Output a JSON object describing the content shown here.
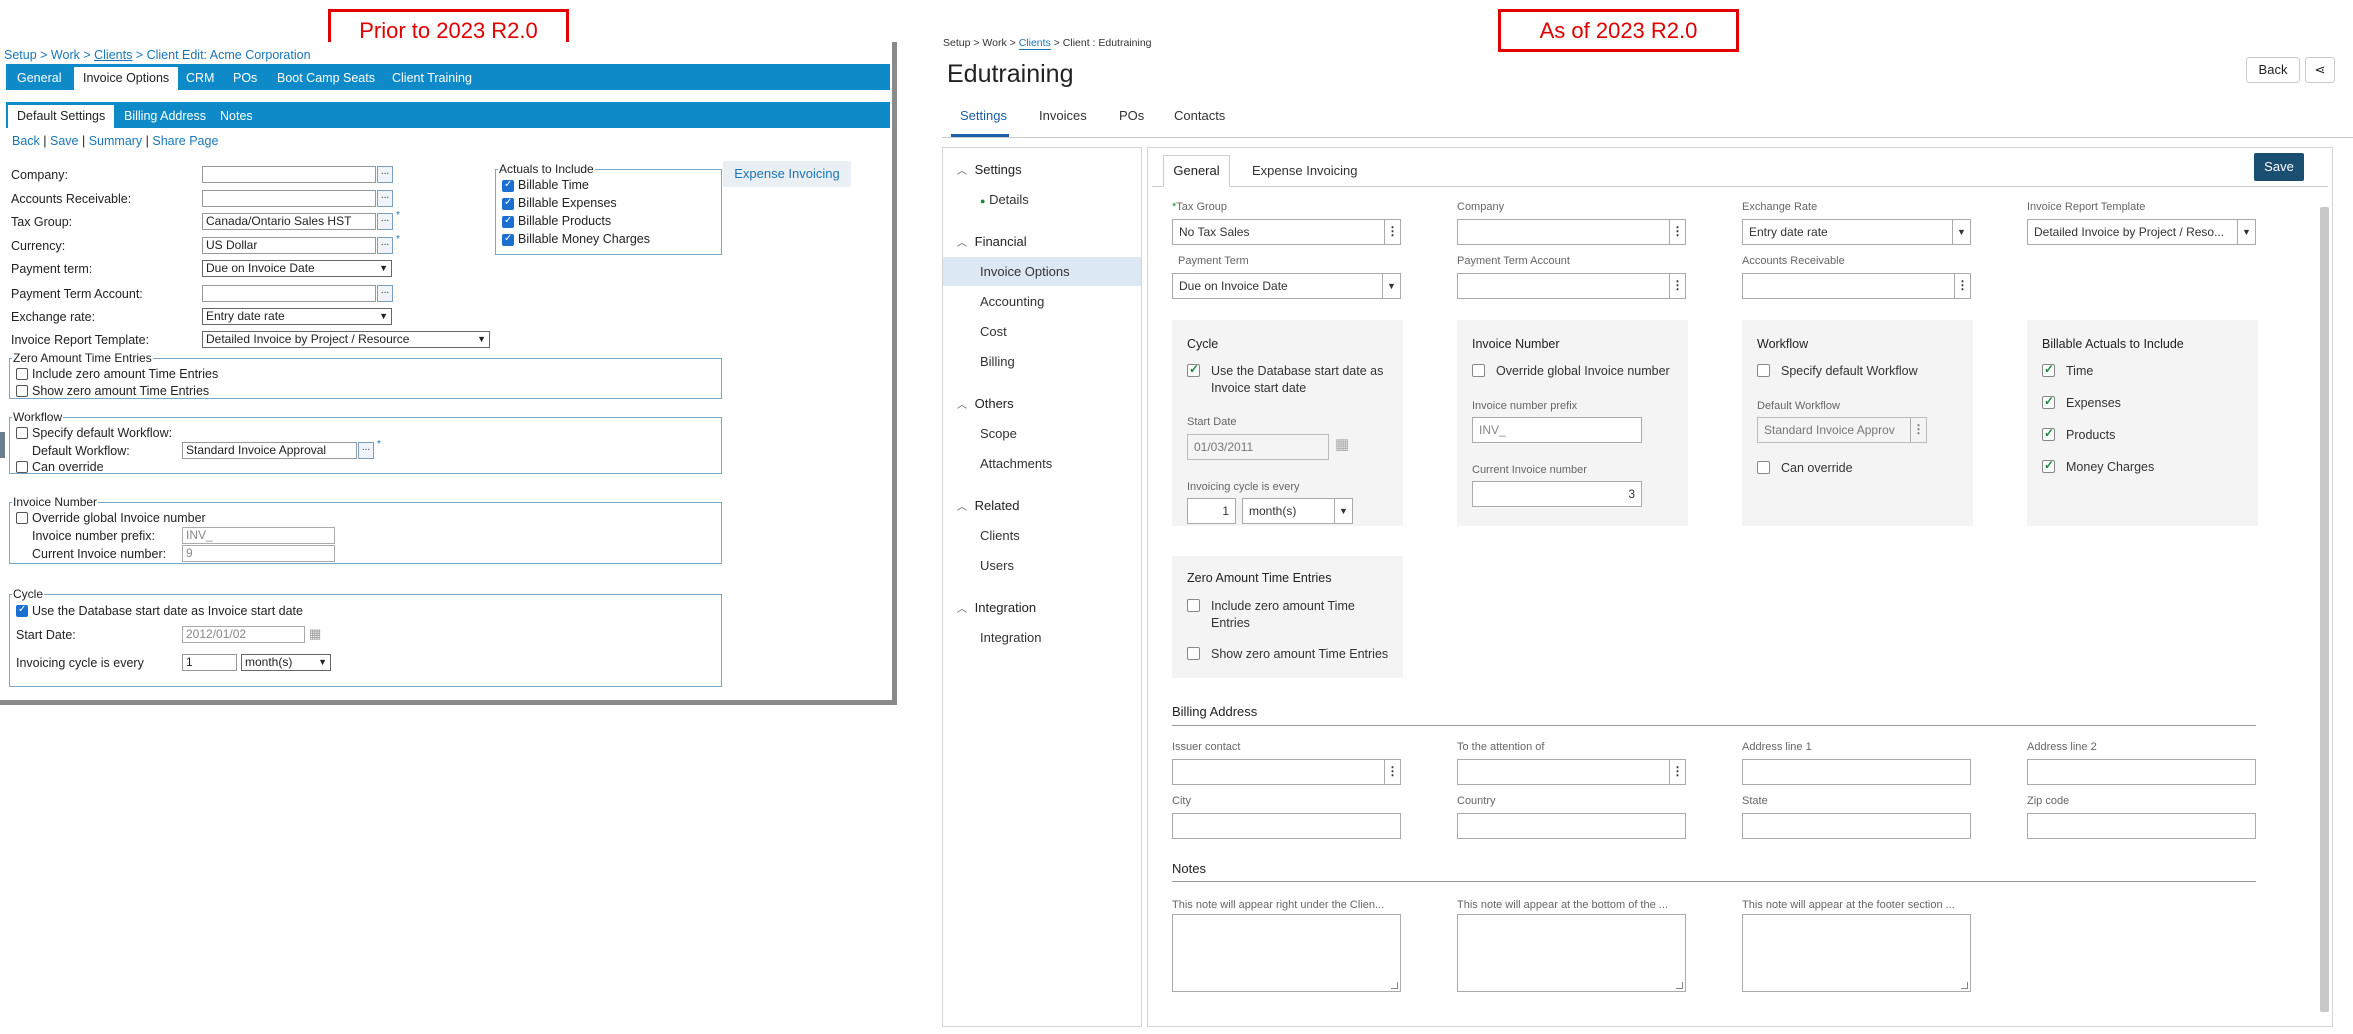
{
  "callouts": {
    "left": "Prior to 2023 R2.0",
    "right": "As of 2023 R2.0"
  },
  "old": {
    "breadcrumb": {
      "setup": "Setup",
      "work": "Work",
      "clients": "Clients",
      "current": "Client Edit: Acme Corporation",
      "sep": " > "
    },
    "tabs": [
      "General",
      "Invoice Options",
      "CRM",
      "POs",
      "Boot Camp Seats",
      "Client Training"
    ],
    "subtabs": [
      "Default Settings",
      "Billing Address",
      "Notes"
    ],
    "links": [
      "Back",
      "Save",
      "Summary",
      "Share Page"
    ],
    "link_sep": " | ",
    "fields": {
      "company": "Company:",
      "ar": "Accounts Receivable:",
      "tax_group": "Tax Group:",
      "tax_group_value": "Canada/Ontario Sales HST",
      "currency": "Currency:",
      "currency_value": "US Dollar",
      "payment_term": "Payment term:",
      "payment_term_value": "Due on Invoice Date",
      "payment_term_account": "Payment Term Account:",
      "exchange_rate": "Exchange rate:",
      "exchange_rate_value": "Entry date rate",
      "invoice_report_template": "Invoice Report Template:",
      "invoice_report_template_value": "Detailed Invoice by Project / Resource"
    },
    "actuals": {
      "legend": "Actuals to Include",
      "items": [
        "Billable Time",
        "Billable Expenses",
        "Billable Products",
        "Billable Money Charges"
      ]
    },
    "expense_invoicing": "Expense Invoicing",
    "zero": {
      "legend": "Zero Amount Time Entries",
      "include": "Include zero amount Time Entries",
      "show": "Show zero amount Time Entries"
    },
    "workflow": {
      "legend": "Workflow",
      "specify": "Specify default Workflow:",
      "default_label": "Default Workflow:",
      "default_value": "Standard Invoice Approval",
      "can_override": "Can override"
    },
    "invnum": {
      "legend": "Invoice Number",
      "override": "Override global Invoice number",
      "prefix_label": "Invoice number prefix:",
      "prefix_value": "INV_",
      "current_label": "Current Invoice number:",
      "current_value": "9"
    },
    "cycle": {
      "legend": "Cycle",
      "use_db": "Use the Database start date as Invoice start date",
      "start_label": "Start Date:",
      "start_value": "2012/01/02",
      "every_label": "Invoicing cycle is every",
      "every_value": "1",
      "unit": "month(s)"
    }
  },
  "new": {
    "breadcrumb": {
      "setup": "Setup",
      "work": "Work",
      "clients": "Clients",
      "client": "Client : Edutraining",
      "sep": " > "
    },
    "title": "Edutraining",
    "back": "Back",
    "tabs": [
      "Settings",
      "Invoices",
      "POs",
      "Contacts"
    ],
    "side": {
      "settings": "Settings",
      "details": "Details",
      "financial": "Financial",
      "invoice_options": "Invoice Options",
      "accounting": "Accounting",
      "cost": "Cost",
      "billing": "Billing",
      "others": "Others",
      "scope": "Scope",
      "attachments": "Attachments",
      "related": "Related",
      "clients": "Clients",
      "users": "Users",
      "integration": "Integration",
      "integration_item": "Integration"
    },
    "subtabs": [
      "General",
      "Expense Invoicing"
    ],
    "save": "Save",
    "fields": {
      "tax_group": "Tax Group",
      "tax_group_value": "No Tax Sales",
      "company": "Company",
      "exchange_rate": "Exchange Rate",
      "exchange_rate_value": "Entry date rate",
      "irt": "Invoice Report Template",
      "irt_value": "Detailed Invoice by Project / Reso...",
      "payment_term": "Payment Term",
      "payment_term_value": "Due on Invoice Date",
      "pta": "Payment Term Account",
      "ar": "Accounts Receivable"
    },
    "cycle": {
      "title": "Cycle",
      "use_db_1": "Use the Database start date as",
      "use_db_2": "Invoice start date",
      "start_label": "Start Date",
      "start_value": "01/03/2011",
      "every_label": "Invoicing cycle is every",
      "every_value": "1",
      "unit": "month(s)"
    },
    "invnum": {
      "title": "Invoice Number",
      "override": "Override global Invoice number",
      "prefix_label": "Invoice number prefix",
      "prefix_value": "INV_",
      "current_label": "Current Invoice number",
      "current_value": "3"
    },
    "workflow": {
      "title": "Workflow",
      "specify": "Specify default Workflow",
      "default_label": "Default Workflow",
      "default_value": "Standard Invoice Approv",
      "can_override": "Can override"
    },
    "actuals": {
      "title": "Billable Actuals to Include",
      "items": [
        "Time",
        "Expenses",
        "Products",
        "Money Charges"
      ]
    },
    "zero": {
      "title": "Zero Amount Time Entries",
      "include_1": "Include zero amount Time",
      "include_2": "Entries",
      "show": "Show zero amount Time Entries"
    },
    "billing": {
      "title": "Billing Address",
      "issuer": "Issuer contact",
      "attention": "To the attention of",
      "addr1": "Address line 1",
      "addr2": "Address line 2",
      "city": "City",
      "country": "Country",
      "state": "State",
      "zip": "Zip code"
    },
    "notes": {
      "title": "Notes",
      "n1": "This note will appear right under the Clien...",
      "n2": "This note will appear at the bottom of the ...",
      "n3": "This note will appear at the footer section ..."
    }
  }
}
